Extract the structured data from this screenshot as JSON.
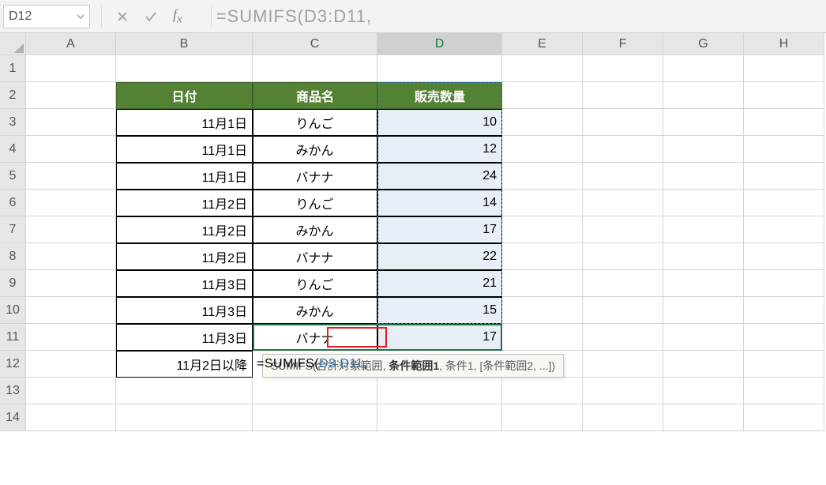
{
  "nameBox": "D12",
  "formulaBar": "=SUMIFS(D3:D11,",
  "columns": [
    "A",
    "B",
    "C",
    "D",
    "E",
    "F",
    "G",
    "H"
  ],
  "rows": [
    "1",
    "2",
    "3",
    "4",
    "5",
    "6",
    "7",
    "8",
    "9",
    "10",
    "11",
    "12",
    "13",
    "14"
  ],
  "headers": {
    "b": "日付",
    "c": "商品名",
    "d": "販売数量"
  },
  "data": [
    {
      "date": "11月1日",
      "item": "りんご",
      "qty": "10"
    },
    {
      "date": "11月1日",
      "item": "みかん",
      "qty": "12"
    },
    {
      "date": "11月1日",
      "item": "バナナ",
      "qty": "24"
    },
    {
      "date": "11月2日",
      "item": "りんご",
      "qty": "14"
    },
    {
      "date": "11月2日",
      "item": "みかん",
      "qty": "17"
    },
    {
      "date": "11月2日",
      "item": "バナナ",
      "qty": "22"
    },
    {
      "date": "11月3日",
      "item": "りんご",
      "qty": "21"
    },
    {
      "date": "11月3日",
      "item": "みかん",
      "qty": "15"
    },
    {
      "date": "11月3日",
      "item": "バナナ",
      "qty": "17"
    }
  ],
  "row12": {
    "label": "11月2日以降",
    "formulaPrefix": "=SUMIFS(",
    "formulaRef": "D3:D11",
    "formulaSuffix": ","
  },
  "tooltip": {
    "fn": "SUMIFS",
    "arg1": "合計対象範囲",
    "arg2": "条件範囲1",
    "arg3": "条件1",
    "arg4": "[条件範囲2, ...]"
  }
}
